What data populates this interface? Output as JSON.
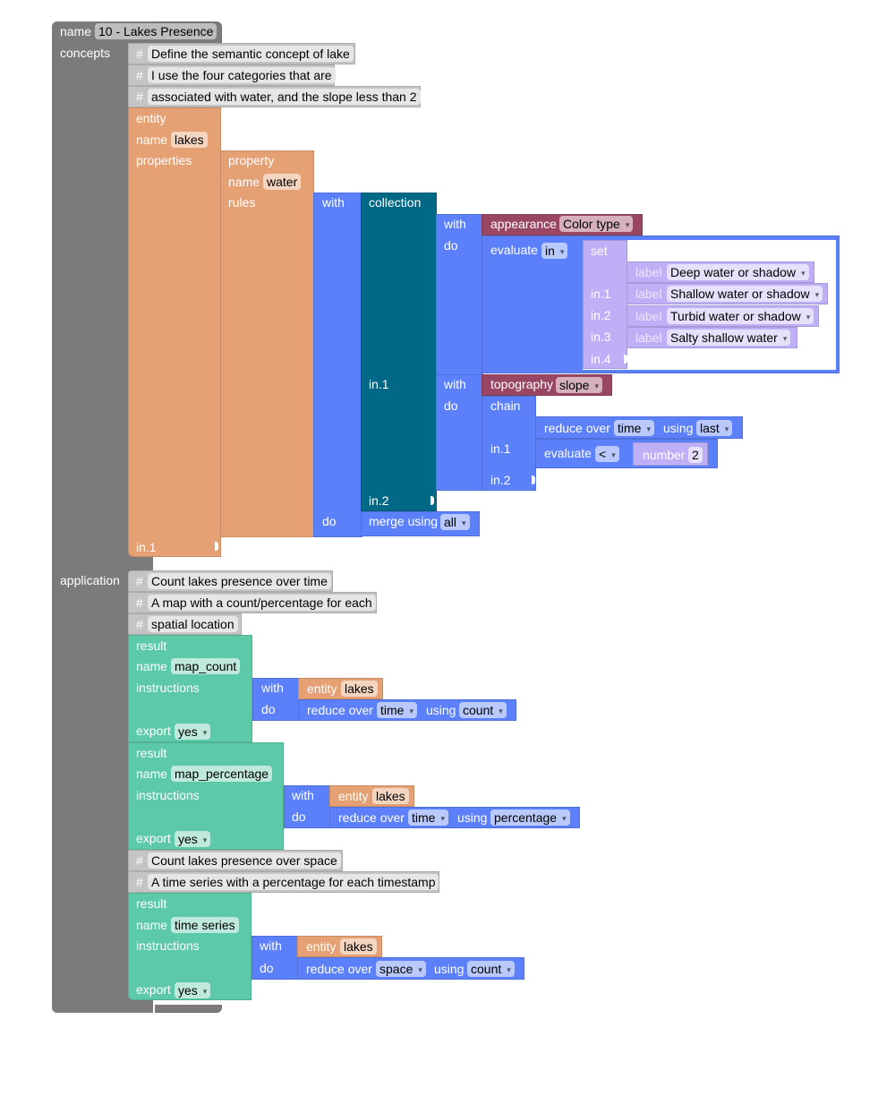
{
  "workflow": {
    "name_label": "name",
    "name_value": "10 - Lakes Presence",
    "concepts_label": "concepts",
    "application_label": "application"
  },
  "concepts": {
    "comments": [
      "Define the semantic concept of lake",
      "I use the four categories that are",
      "associated with water, and the slope less than 2"
    ],
    "entity": {
      "type_label": "entity",
      "name_label": "name",
      "name_value": "lakes",
      "properties_label": "properties",
      "in1_label": "in.1",
      "property": {
        "type_label": "property",
        "name_label": "name",
        "name_value": "water",
        "rules_label": "rules",
        "with_label": "with",
        "do_label": "do",
        "collection": {
          "label": "collection",
          "in1_label": "in.1",
          "in2_label": "in.2"
        },
        "first": {
          "with_label": "with",
          "do_label": "do",
          "appearance_label": "appearance",
          "appearance_value": "Color type",
          "evaluate_label": "evaluate",
          "evaluate_op": "in",
          "set_label": "set",
          "set_inputs": [
            "",
            "in.1",
            "in.2",
            "in.3",
            "in.4"
          ],
          "label_word": "label",
          "labels": [
            "Deep water or shadow",
            "Shallow water or shadow",
            "Turbid water or shadow",
            "Salty shallow water"
          ]
        },
        "second": {
          "with_label": "with",
          "do_label": "do",
          "topography_label": "topography",
          "topography_value": "slope",
          "chain_label": "chain",
          "in1_label": "in.1",
          "in2_label": "in.2",
          "reduce_label": "reduce over",
          "reduce_over": "time",
          "using_label": "using",
          "reduce_using": "last",
          "evaluate_label": "evaluate",
          "evaluate_op": "<",
          "number_label": "number",
          "number_value": "2"
        },
        "merge_label": "merge using",
        "merge_value": "all"
      }
    }
  },
  "application": {
    "comments_1": [
      "Count lakes presence over time",
      "A map with a count/percentage for each",
      "spatial location"
    ],
    "comments_2": [
      "Count lakes presence over space",
      "A time series with a percentage for each timestamp"
    ],
    "results": [
      {
        "result_label": "result",
        "name_label": "name",
        "name_value": "map_count",
        "instructions_label": "instructions",
        "with_label": "with",
        "do_label": "do",
        "entity_label": "entity",
        "entity_value": "lakes",
        "reduce_label": "reduce over",
        "reduce_over": "time",
        "using_label": "using",
        "reduce_using": "count",
        "export_label": "export",
        "export_value": "yes"
      },
      {
        "result_label": "result",
        "name_label": "name",
        "name_value": "map_percentage",
        "instructions_label": "instructions",
        "with_label": "with",
        "do_label": "do",
        "entity_label": "entity",
        "entity_value": "lakes",
        "reduce_label": "reduce over",
        "reduce_over": "time",
        "using_label": "using",
        "reduce_using": "percentage",
        "export_label": "export",
        "export_value": "yes"
      },
      {
        "result_label": "result",
        "name_label": "name",
        "name_value": "time series",
        "instructions_label": "instructions",
        "with_label": "with",
        "do_label": "do",
        "entity_label": "entity",
        "entity_value": "lakes",
        "reduce_label": "reduce over",
        "reduce_over": "space",
        "using_label": "using",
        "reduce_using": "count",
        "export_label": "export",
        "export_value": "yes"
      }
    ]
  },
  "colors": {
    "workflow": "#7b7b7b",
    "comment": "#c4c4c4",
    "entity": "#e5a073",
    "logic": "#5b80fa",
    "collection": "#016886",
    "layer": "#994664",
    "set": "#bfaff6",
    "result": "#5ccaa8"
  }
}
